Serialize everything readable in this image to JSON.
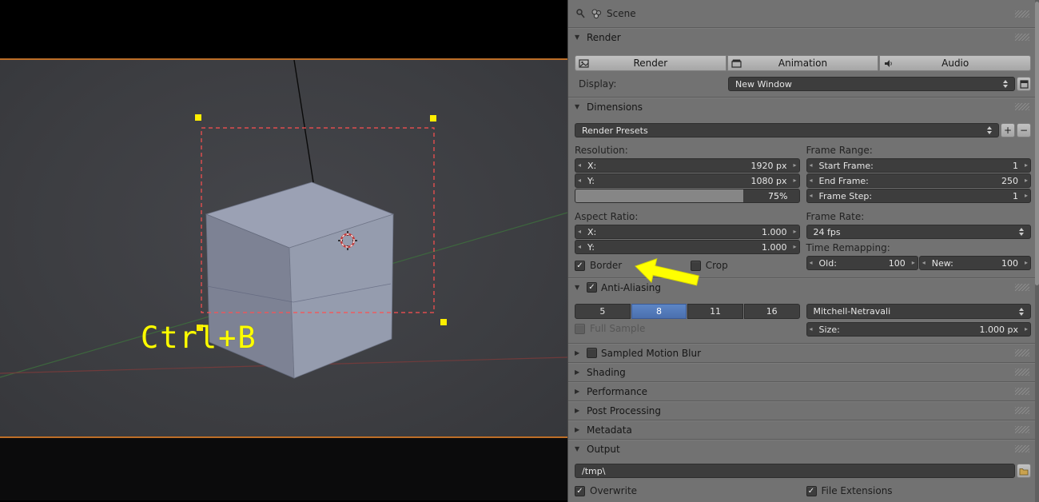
{
  "viewport": {
    "shortcut_label": "Ctrl+B"
  },
  "header": {
    "breadcrumb": "Scene"
  },
  "render": {
    "title": "Render",
    "render_btn": "Render",
    "animation_btn": "Animation",
    "audio_btn": "Audio",
    "display_label": "Display:",
    "display_value": "New Window"
  },
  "dimensions": {
    "title": "Dimensions",
    "presets": "Render Presets",
    "plus": "+",
    "minus": "−",
    "resolution_label": "Resolution:",
    "res_x_label": "X:",
    "res_x_value": "1920 px",
    "res_y_label": "Y:",
    "res_y_value": "1080 px",
    "res_scale": "75%",
    "frame_range_label": "Frame Range:",
    "start_label": "Start Frame:",
    "start_value": "1",
    "end_label": "End Frame:",
    "end_value": "250",
    "step_label": "Frame Step:",
    "step_value": "1",
    "aspect_label": "Aspect Ratio:",
    "aspect_x_label": "X:",
    "aspect_x_value": "1.000",
    "aspect_y_label": "Y:",
    "aspect_y_value": "1.000",
    "frame_rate_label": "Frame Rate:",
    "frame_rate_value": "24 fps",
    "border_label": "Border",
    "crop_label": "Crop",
    "time_remap_label": "Time Remapping:",
    "old_label": "Old:",
    "old_value": "100",
    "new_label": "New:",
    "new_value": "100"
  },
  "anti_aliasing": {
    "title": "Anti-Aliasing",
    "samples": [
      "5",
      "8",
      "11",
      "16"
    ],
    "selected_sample": "8",
    "filter": "Mitchell-Netravali",
    "full_sample_label": "Full Sample",
    "size_label": "Size:",
    "size_value": "1.000 px"
  },
  "sections": {
    "motion_blur": "Sampled Motion Blur",
    "shading": "Shading",
    "performance": "Performance",
    "post_processing": "Post Processing",
    "metadata": "Metadata"
  },
  "output": {
    "title": "Output",
    "path": "/tmp\\",
    "overwrite_label": "Overwrite",
    "file_ext_label": "File Extensions"
  },
  "colors": {
    "selection_blue": "#4f78b8",
    "render_border_red": "#ff5050",
    "handle_yellow": "#ffee00",
    "annotation_yellow": "#ffff00",
    "viewport_edge_orange": "#bd6e27",
    "panel_bg": "#727272",
    "widget_bg": "#3d3d3d"
  }
}
